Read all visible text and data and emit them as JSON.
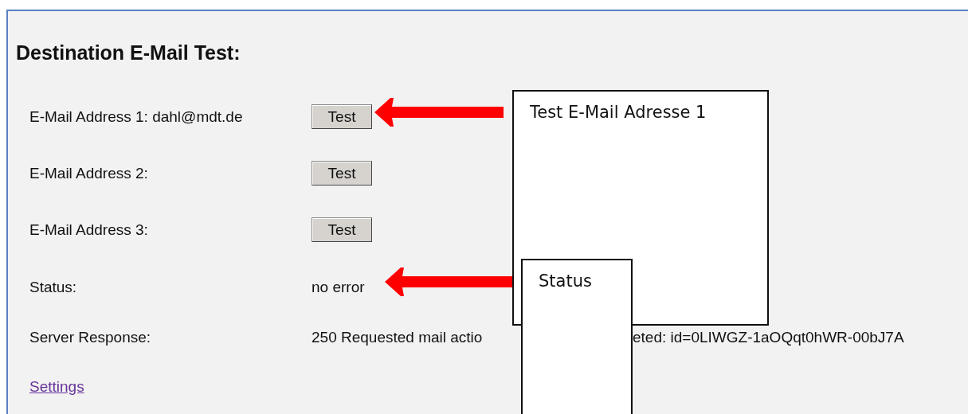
{
  "heading": "Destination E-Mail Test:",
  "addresses": [
    {
      "label": "E-Mail Address 1: dahl@mdt.de",
      "button": "Test"
    },
    {
      "label": "E-Mail Address 2:",
      "button": "Test"
    },
    {
      "label": "E-Mail Address 3:",
      "button": "Test"
    }
  ],
  "status": {
    "label": "Status:",
    "value": "no error"
  },
  "server_response": {
    "label": "Server Response:",
    "value_parts": [
      "250 Requested mail actio",
      "eted: id=0LIWGZ-1aOQqt0hWR-00bJ7A"
    ]
  },
  "settings_link": "Settings",
  "callouts": [
    {
      "text": "Test E-Mail Adresse 1"
    },
    {
      "text": "Status"
    }
  ]
}
